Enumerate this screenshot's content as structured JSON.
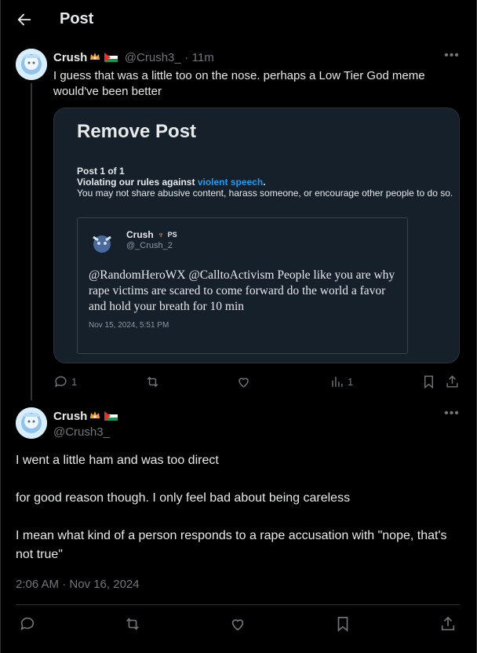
{
  "header": {
    "title": "Post"
  },
  "reply_post": {
    "name": "Crush",
    "handle": "@Crush3_",
    "dot": "·",
    "time": "11m",
    "text": "I guess that was a little too on the nose. perhaps a Low Tier God meme would've been better",
    "actions": {
      "replies": "1",
      "views": "1"
    },
    "icons": [
      "reply-icon",
      "retweet-icon",
      "like-icon",
      "views-icon",
      "bookmark-icon",
      "share-icon"
    ]
  },
  "removal_card": {
    "title": "Remove Post",
    "count": "Post 1 of 1",
    "rule_prefix": "Violating our rules against ",
    "rule_link": "violent speech",
    "rule_suffix": ".",
    "explanation": "You may not share abusive content, harass someone, or encourage other people to do so.",
    "embedded": {
      "name": "Crush",
      "suffix": "PS",
      "handle": "@_Crush_2",
      "text": "@RandomHeroWX @CalltoActivism People like you are why rape victims are scared to come forward do the world a favor and hold your breath for 10 min",
      "date": "Nov 15, 2024, 5:51 PM"
    }
  },
  "main_post": {
    "name": "Crush",
    "handle": "@Crush3_",
    "paragraphs": [
      "I went a little ham and was too direct",
      "for good reason though. I only feel bad about being careless",
      "I mean what kind of a person responds to a rape accusation with \"nope, that's not true\""
    ],
    "timestamp": "2:06 AM · Nov 16, 2024"
  },
  "colors": {
    "accent": "#1d9bf0",
    "muted": "#71767b",
    "card_bg": "#15202b",
    "border": "#2f3336"
  }
}
